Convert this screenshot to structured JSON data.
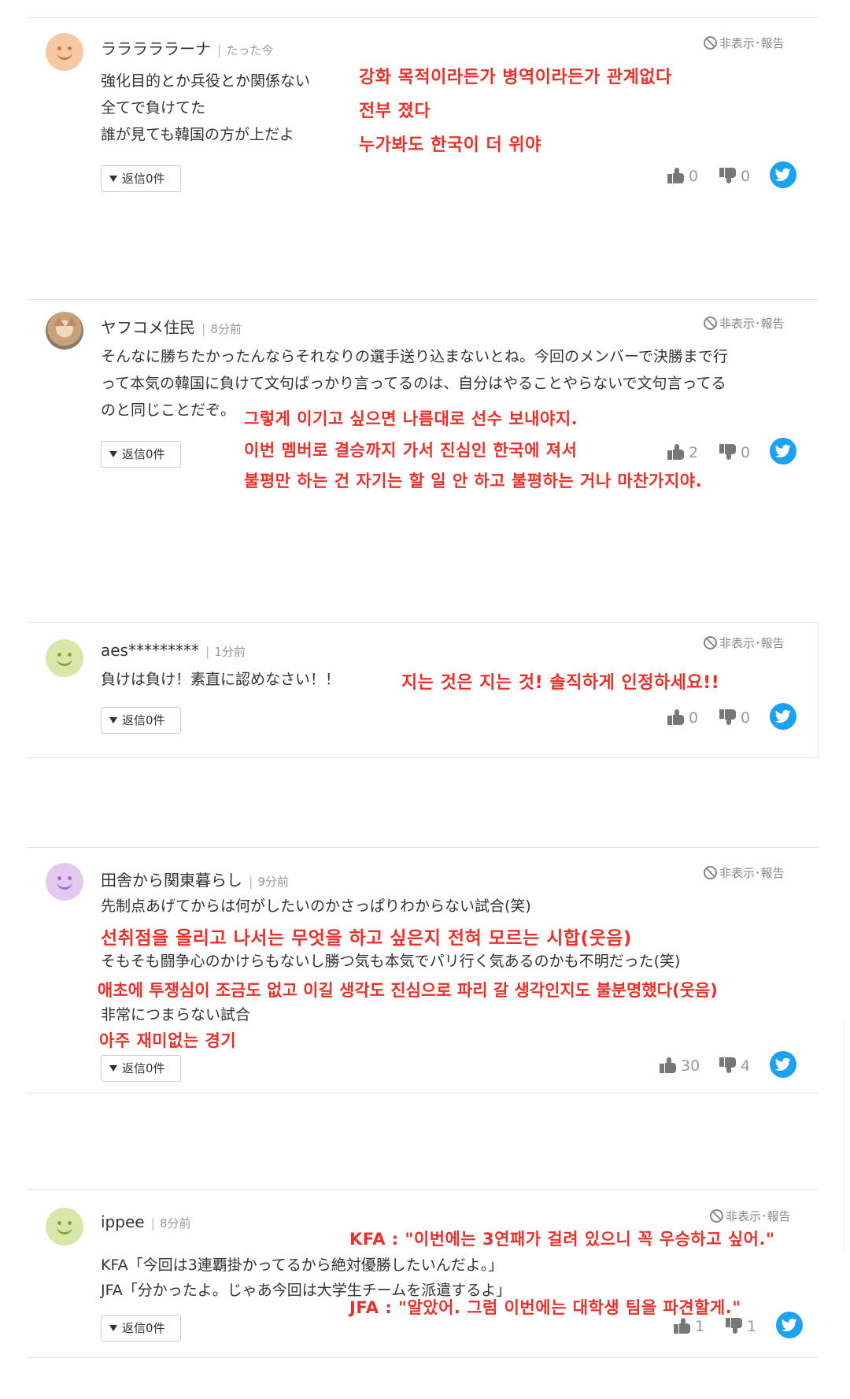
{
  "common": {
    "hide_label": "非表示･報告",
    "reply_label": "返信0件"
  },
  "comments": [
    {
      "user": "ラララララーナ",
      "time": "たった今",
      "avatar_icon": "smiley-face-icon",
      "avatar_color": "#f6c9a4",
      "jp_lines": [
        "強化目的とか兵役とか関係ない",
        "全てで負けてた",
        "誰が見ても韓国の方が上だよ"
      ],
      "kr_lines": [
        "강화 목적이라든가 병역이라든가 관계없다",
        "전부 졌다",
        "누가봐도 한국이 더 위야"
      ],
      "likes": "0",
      "dislikes": "0"
    },
    {
      "user": "ヤフコメ住民",
      "time": "8分前",
      "avatar_icon": "cat-photo-avatar",
      "jp_lines": [
        "そんなに勝ちたかったんならそれなりの選手送り込まないとね。今回のメンバーで決勝まで行",
        "って本気の韓国に負けて文句ばっかり言ってるのは、自分はやることやらないで文句言ってる",
        "のと同じことだぞ。"
      ],
      "kr_lines": [
        "그렇게 이기고 싶으면 나름대로 선수 보내야지.",
        "이번 멤버로 결승까지 가서 진심인 한국에 져서",
        "불평만 하는 건 자기는 할 일 안 하고 불평하는 거나 마찬가지야."
      ],
      "likes": "2",
      "dislikes": "0"
    },
    {
      "user": "aes*********",
      "time": "1分前",
      "avatar_icon": "smiley-face-icon",
      "avatar_color": "#d6e7a8",
      "jp_lines": [
        "負けは負け！素直に認めなさい！！"
      ],
      "kr_lines": [
        "지는 것은 지는 것! 솔직하게 인정하세요!!"
      ],
      "likes": "0",
      "dislikes": "0"
    },
    {
      "user": "田舎から関東暮らし",
      "time": "9分前",
      "avatar_icon": "smiley-face-icon",
      "avatar_color": "#e3c9ef",
      "jp_lines": [
        "先制点あげてからは何がしたいのかさっぱりわからない試合(笑)",
        "そもそも闘争心のかけらもないし勝つ気も本気でパリ行く気あるのかも不明だった(笑)",
        "非常につまらない試合"
      ],
      "kr_lines": [
        "선취점을 올리고 나서는 무엇을 하고 싶은지 전혀 모르는 시합(웃음)",
        "애초에 투쟁심이 조금도 없고 이길 생각도 진심으로 파리 갈 생각인지도 불분명했다(웃음)",
        "아주 재미없는 경기"
      ],
      "likes": "30",
      "dislikes": "4"
    },
    {
      "user": "ippee",
      "time": "8分前",
      "avatar_icon": "smiley-face-icon",
      "avatar_color": "#d6e7a8",
      "jp_lines": [
        "KFA「今回は3連覇掛かってるから絶対優勝したいんだよ。」",
        "JFA「分かったよ。じゃあ今回は大学生チームを派遣するよ」"
      ],
      "kr_lines": [
        "KFA : \"이번에는 3연패가 걸려 있으니 꼭 우승하고 싶어.\"",
        "JFA : \"알았어. 그럼 이번에는 대학생 팀을 파견할게.\""
      ],
      "likes": "1",
      "dislikes": "1"
    }
  ]
}
